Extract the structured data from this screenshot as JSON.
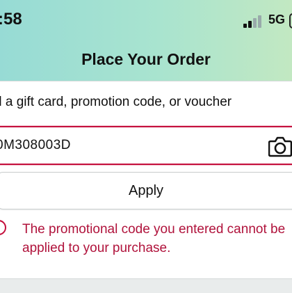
{
  "status_bar": {
    "time": ":58",
    "network": "5G"
  },
  "header": {
    "title": "Place Your Order"
  },
  "gift_section": {
    "label": "d a gift card, promotion code, or voucher",
    "code_value": "0M308003D",
    "apply_label": "Apply",
    "error_message": "The promotional code you entered cannot be applied to your purchase."
  },
  "colors": {
    "error": "#c40f3c",
    "header_gradient_start": "#97dbd5",
    "header_gradient_end": "#c2e8c2"
  },
  "icons": [
    "signal-icon",
    "battery-icon",
    "camera-icon",
    "error-icon"
  ]
}
